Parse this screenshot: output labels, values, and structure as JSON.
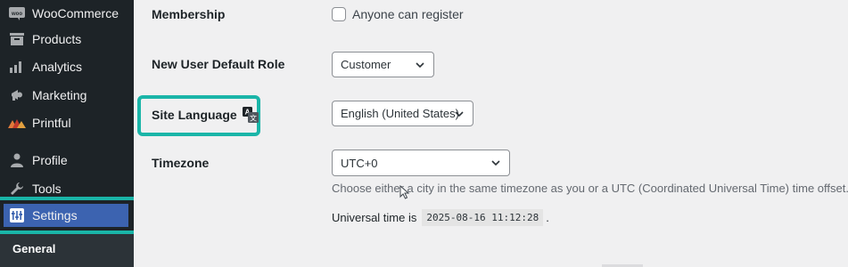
{
  "sidebar": {
    "items": [
      {
        "label": "WooCommerce",
        "icon": "woo-icon"
      },
      {
        "label": "Products",
        "icon": "archive-icon"
      },
      {
        "label": "Analytics",
        "icon": "bar-chart-icon"
      },
      {
        "label": "Marketing",
        "icon": "megaphone-icon"
      },
      {
        "label": "Printful",
        "icon": "printful-logo-icon"
      },
      {
        "label": "Profile",
        "icon": "user-icon"
      },
      {
        "label": "Tools",
        "icon": "wrench-icon"
      },
      {
        "label": "Settings",
        "icon": "settings-icon"
      }
    ],
    "submenu": {
      "current": "General"
    }
  },
  "settings": {
    "membership": {
      "label": "Membership",
      "checkbox_label": "Anyone can register",
      "checked": false
    },
    "default_role": {
      "label": "New User Default Role",
      "value": "Customer"
    },
    "site_language": {
      "label": "Site Language",
      "value": "English (United States)"
    },
    "timezone": {
      "label": "Timezone",
      "value": "UTC+0",
      "description": "Choose either a city in the same timezone as you or a UTC (Coordinated Universal Time) time offset.",
      "universal_time_label": "Universal time is",
      "universal_time_value": "2025-08-16 11:12:28",
      "universal_time_suffix": "."
    }
  },
  "colors": {
    "sidebar_bg": "#1d2327",
    "highlight": "#1ab5a8",
    "active_menu": "#3c63b0"
  }
}
